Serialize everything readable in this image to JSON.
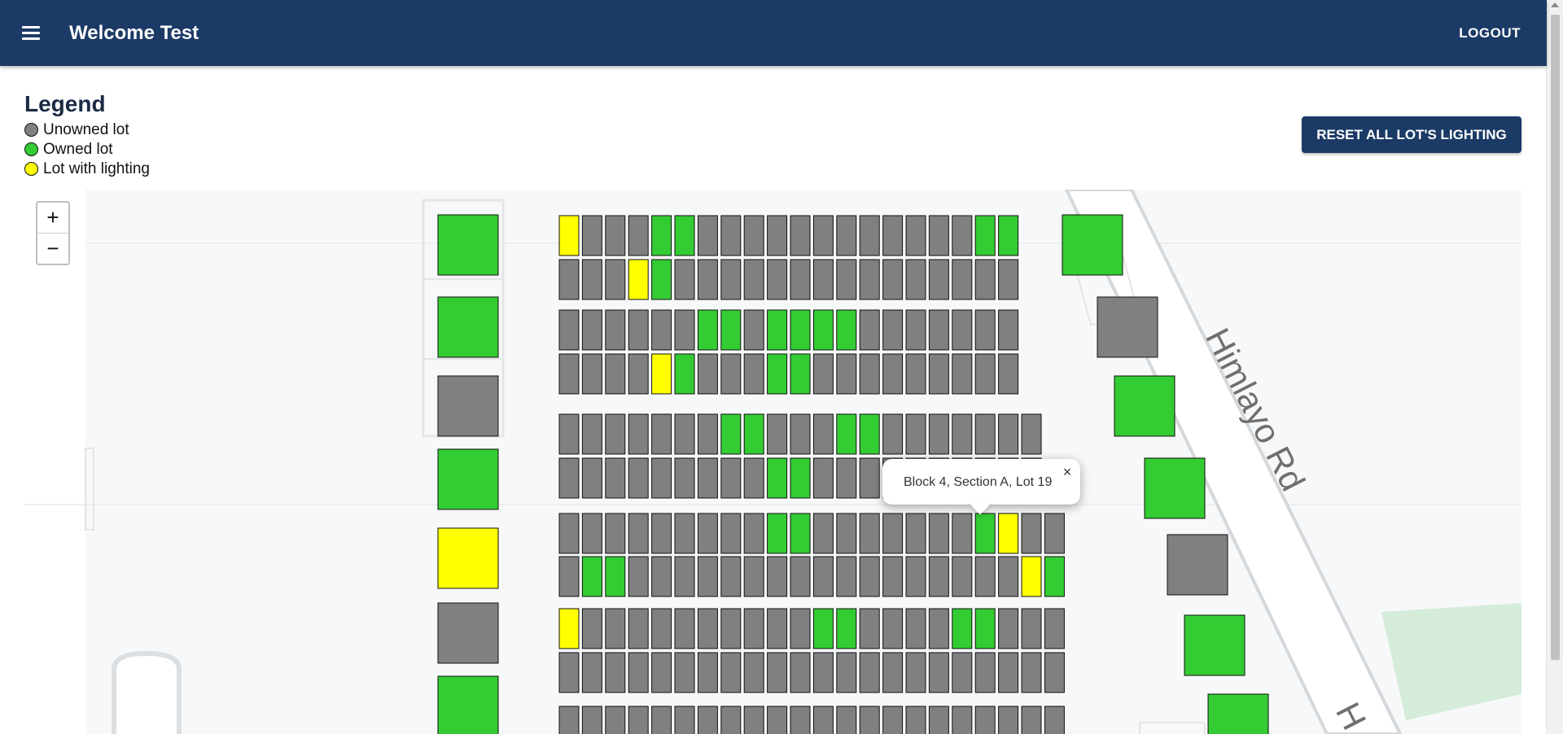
{
  "appbar": {
    "title": "Welcome Test",
    "logout_label": "LOGOUT",
    "background": "#1b3a66"
  },
  "legend": {
    "title": "Legend",
    "items": [
      {
        "label": "Unowned lot",
        "color": "#808080"
      },
      {
        "label": "Owned lot",
        "color": "#33cc33"
      },
      {
        "label": "Lot with lighting",
        "color": "#ffff00"
      }
    ]
  },
  "reset_button": {
    "label": "RESET ALL LOT'S LIGHTING"
  },
  "map": {
    "road_label": "Himlayo Rd",
    "road_label_partial": "H",
    "zoom_in_label": "+",
    "zoom_out_label": "−",
    "popup": {
      "text": "Block 4, Section A, Lot 19",
      "close_label": "×"
    },
    "status_codes": {
      "U": "unowned",
      "O": "owned",
      "L": "lighting"
    },
    "block_rows": [
      "LUUUOOUUUUUUUUUUUUOO",
      "UUULOUUUUUUUUUUUUUUU",
      "UUUUUUOOUOOOOUUUUUUU",
      "UUUULOUUUOOUUUUUUUUU",
      "UUUUUUUOOUUUOOUUUUUUU",
      "UUUUUUUUUOOUUUUUUUUUU",
      "UUUUUUUUUOOUUUUUUUOLUU",
      "UOOUUUUUUUUUUUUUUUUULO",
      "LUUUUUUUUUUOOUUUUOOUUU",
      "UUUUUUUUUUUUUUUUUUUUUU",
      "UUUUUUUUUUUUUUUUUUUUUU"
    ],
    "left_column_lots": [
      "O",
      "O",
      "U",
      "O",
      "L",
      "U",
      "O"
    ],
    "right_column_lots": [
      "O",
      "U",
      "O",
      "O",
      "U",
      "O",
      "O"
    ]
  }
}
